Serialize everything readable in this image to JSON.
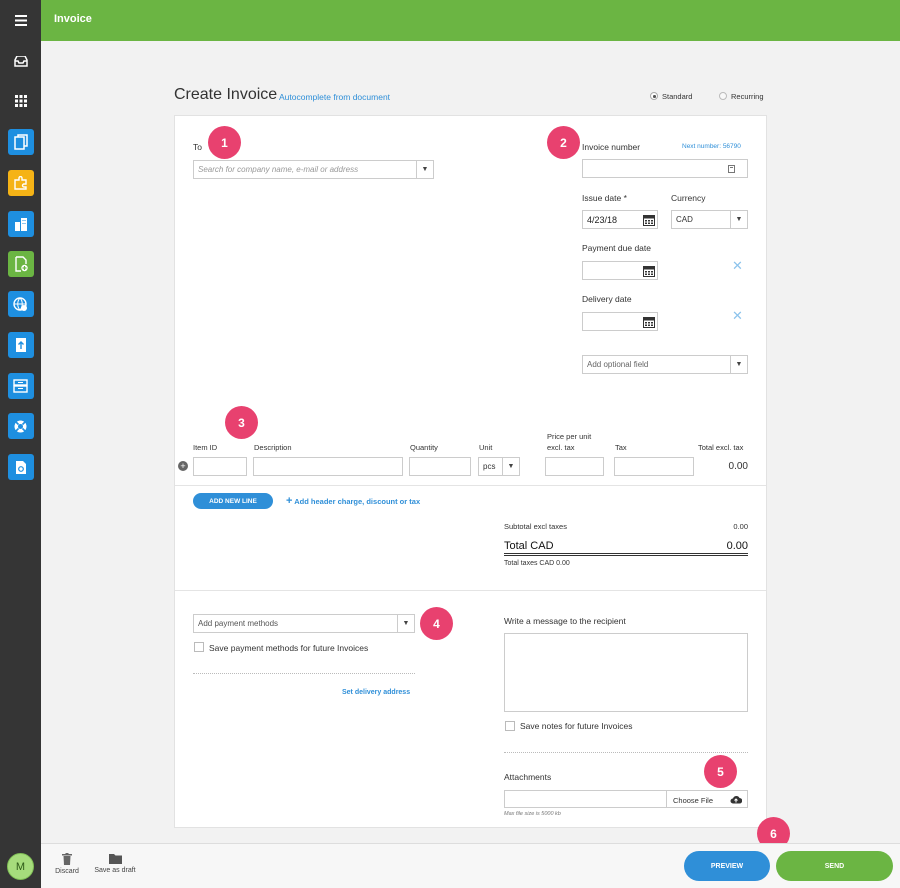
{
  "app": {
    "title": "Invoice"
  },
  "sidebar": {
    "items": [
      {
        "name": "menu-icon"
      },
      {
        "name": "inbox-icon"
      },
      {
        "name": "apps-grid-icon"
      },
      {
        "name": "documents-icon",
        "color": "#1e8fe0"
      },
      {
        "name": "puzzle-icon",
        "color": "#f5b316"
      },
      {
        "name": "building-icon",
        "color": "#1e8fe0"
      },
      {
        "name": "add-document-icon",
        "color": "#6bb543"
      },
      {
        "name": "globe-settings-icon",
        "color": "#1e8fe0"
      },
      {
        "name": "upload-icon",
        "color": "#1e8fe0"
      },
      {
        "name": "archive-icon",
        "color": "#1e8fe0"
      },
      {
        "name": "lifebuoy-icon",
        "color": "#1e8fe0"
      },
      {
        "name": "camera-doc-icon",
        "color": "#1e8fe0"
      }
    ],
    "avatar": "M"
  },
  "page": {
    "heading": "Create Invoice",
    "autocomplete_link": "Autocomplete from document",
    "type_standard": "Standard",
    "type_recurring": "Recurring"
  },
  "recipient": {
    "to_label": "To",
    "search_placeholder": "Search for company name, e-mail or address"
  },
  "details": {
    "invoice_number_label": "Invoice number",
    "next_number": "Next number: 56790",
    "issue_date_label": "Issue date *",
    "issue_date_value": "4/23/18",
    "currency_label": "Currency",
    "currency_value": "CAD",
    "payment_due_label": "Payment due date",
    "delivery_date_label": "Delivery date",
    "optional_field_placeholder": "Add optional field"
  },
  "lines": {
    "col_item_id": "Item ID",
    "col_description": "Description",
    "col_quantity": "Quantity",
    "col_unit": "Unit",
    "col_price_line1": "Price per unit",
    "col_price_line2": "excl. tax",
    "col_tax": "Tax",
    "col_total": "Total excl. tax",
    "unit_value": "pcs",
    "line_total": "0.00",
    "add_line_button": "ADD NEW LINE",
    "add_header_link": "Add header charge, discount or tax"
  },
  "totals": {
    "subtotal_label": "Subtotal excl taxes",
    "subtotal_value": "0.00",
    "total_label": "Total CAD",
    "total_value": "0.00",
    "total_taxes": "Total taxes CAD 0.00"
  },
  "payment": {
    "placeholder": "Add payment methods",
    "save_label": "Save payment methods for future Invoices",
    "delivery_link": "Set delivery address"
  },
  "message": {
    "label": "Write a message to the recipient",
    "save_notes": "Save notes for future Invoices"
  },
  "attachments": {
    "label": "Attachments",
    "choose_file": "Choose File",
    "max_size": "Max file size is 5000 kb"
  },
  "badges": [
    "1",
    "2",
    "3",
    "4",
    "5",
    "6"
  ],
  "bottom": {
    "discard": "Discard",
    "save_draft": "Save as draft",
    "preview": "PREVIEW",
    "send": "SEND"
  },
  "colors": {
    "brand_green": "#6bb543",
    "accent_blue": "#2f8fd8",
    "badge_pink": "#e8416f",
    "sidebar_dark": "#353535"
  }
}
